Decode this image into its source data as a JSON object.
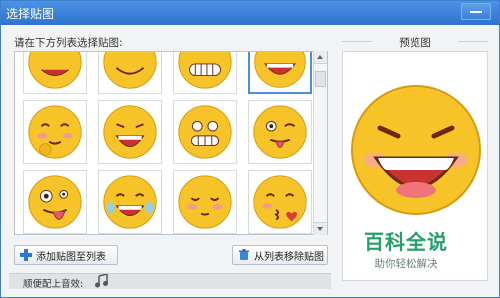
{
  "window": {
    "title": "选择贴图"
  },
  "list": {
    "label": "请在下方列表选择贴图:"
  },
  "buttons": {
    "add_label": "添加贴图至列表",
    "remove_label": "从列表移除贴图"
  },
  "preview": {
    "label": "预览图"
  },
  "sound": {
    "label": "顺便配上音效:"
  },
  "watermark": {
    "title": "百科全说",
    "subtitle": "助你轻松解决"
  },
  "colors": {
    "accent": "#3b7fd9",
    "emoji_yellow": "#f6c428",
    "emoji_outline": "#d89a0e",
    "mouth_red": "#c8322f",
    "watermark_green": "#24a06a"
  },
  "stickers": [
    {
      "name": "grin-face",
      "selected": false
    },
    {
      "name": "smile-face",
      "selected": false
    },
    {
      "name": "teeth-grin-face",
      "selected": false
    },
    {
      "name": "laugh-face",
      "selected": true
    },
    {
      "name": "shy-face",
      "selected": false
    },
    {
      "name": "cheeky-laugh-face",
      "selected": false
    },
    {
      "name": "mischief-grin-face",
      "selected": false
    },
    {
      "name": "wink-tongue-face",
      "selected": false
    },
    {
      "name": "crazy-tongue-face",
      "selected": false
    },
    {
      "name": "tears-of-joy-face",
      "selected": false
    },
    {
      "name": "sleepy-face",
      "selected": false
    },
    {
      "name": "kiss-face",
      "selected": false
    }
  ]
}
